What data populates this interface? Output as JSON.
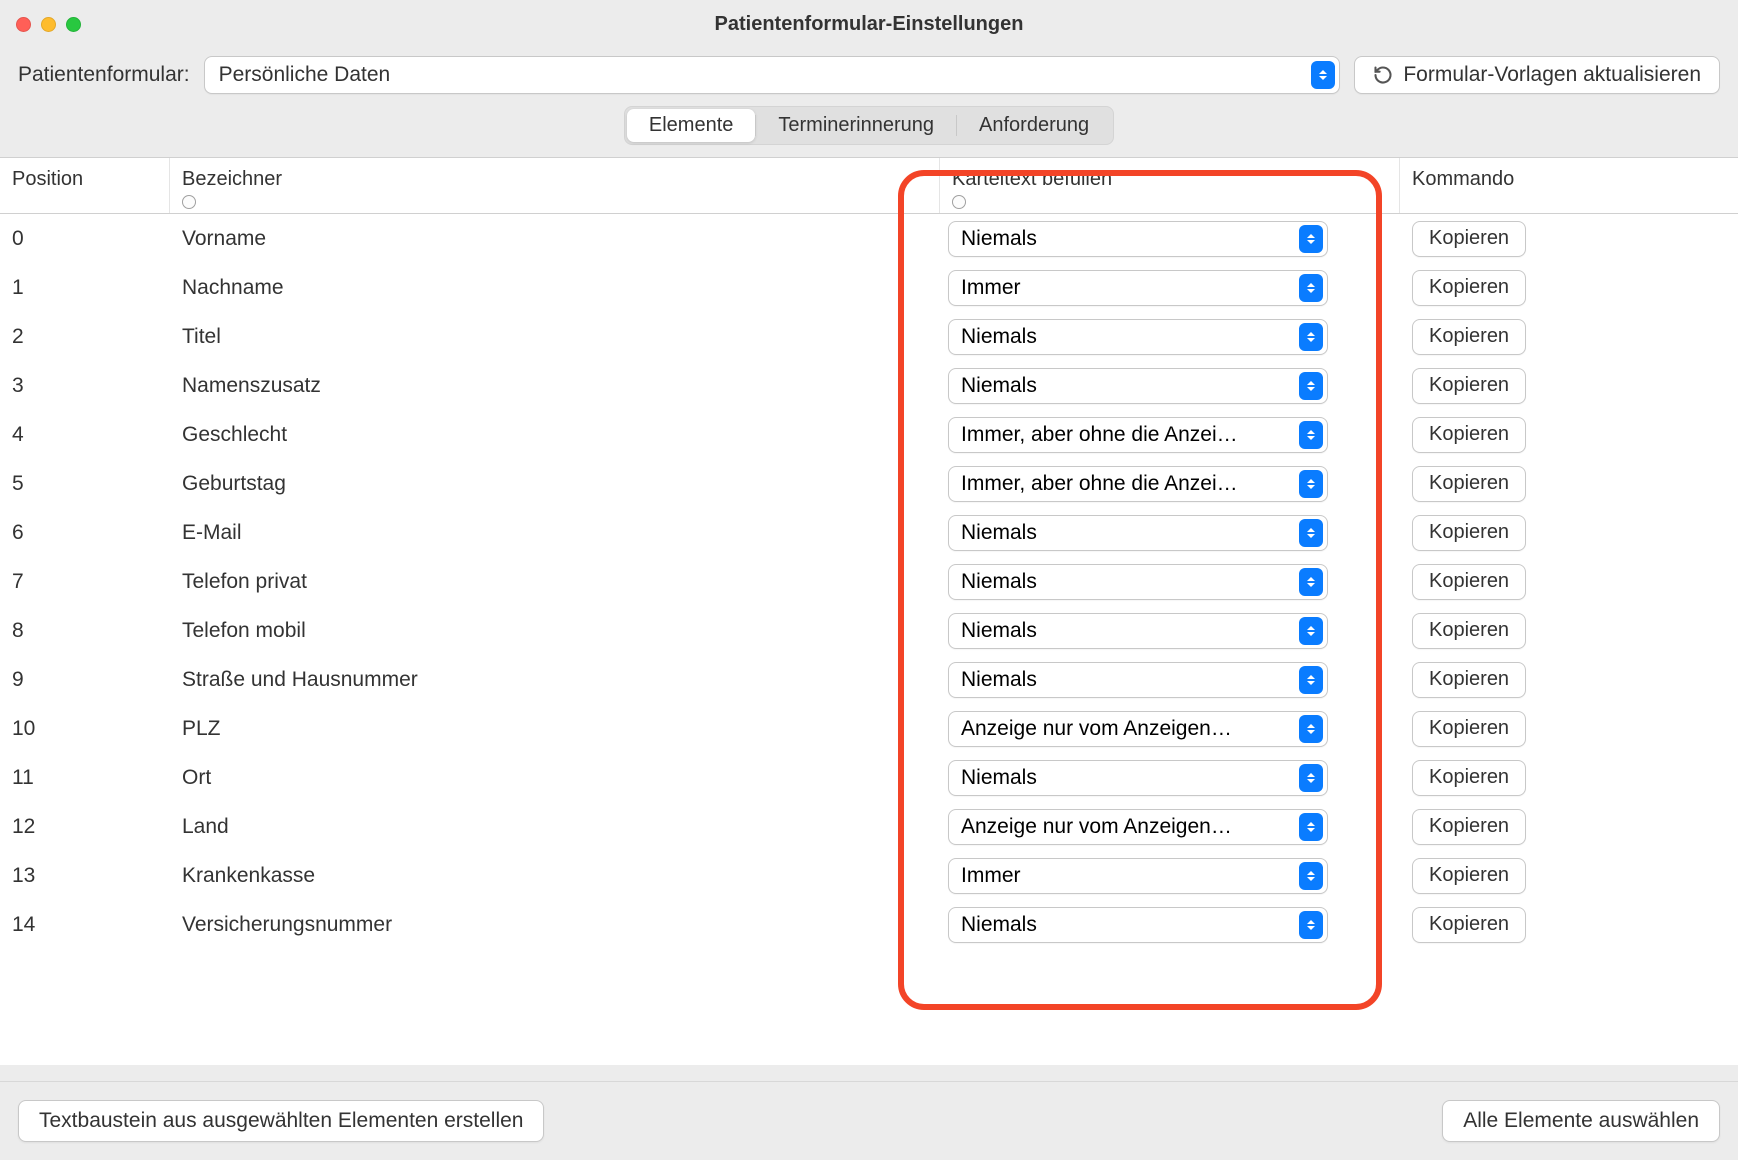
{
  "window": {
    "title": "Patientenformular-Einstellungen"
  },
  "toolbar": {
    "form_label": "Patientenformular:",
    "selected_form": "Persönliche Daten",
    "update_templates": "Formular-Vorlagen aktualisieren"
  },
  "tabs": {
    "elements": "Elemente",
    "reminder": "Terminerinnerung",
    "requirement": "Anforderung"
  },
  "table": {
    "headers": {
      "position": "Position",
      "identifier": "Bezeichner",
      "fill_card_text": "Karteitext befüllen",
      "command": "Kommando"
    },
    "copy_label": "Kopieren",
    "rows": [
      {
        "position": "0",
        "identifier": "Vorname",
        "fill": "Niemals"
      },
      {
        "position": "1",
        "identifier": "Nachname",
        "fill": "Immer"
      },
      {
        "position": "2",
        "identifier": "Titel",
        "fill": "Niemals"
      },
      {
        "position": "3",
        "identifier": "Namenszusatz",
        "fill": "Niemals"
      },
      {
        "position": "4",
        "identifier": "Geschlecht",
        "fill": "Immer, aber ohne die Anzei…"
      },
      {
        "position": "5",
        "identifier": "Geburtstag",
        "fill": "Immer, aber ohne die Anzei…"
      },
      {
        "position": "6",
        "identifier": "E-Mail",
        "fill": "Niemals"
      },
      {
        "position": "7",
        "identifier": "Telefon privat",
        "fill": "Niemals"
      },
      {
        "position": "8",
        "identifier": "Telefon mobil",
        "fill": "Niemals"
      },
      {
        "position": "9",
        "identifier": "Straße und Hausnummer",
        "fill": "Niemals"
      },
      {
        "position": "10",
        "identifier": "PLZ",
        "fill": "Anzeige nur vom Anzeigen…"
      },
      {
        "position": "11",
        "identifier": "Ort",
        "fill": "Niemals"
      },
      {
        "position": "12",
        "identifier": "Land",
        "fill": "Anzeige nur vom Anzeigen…"
      },
      {
        "position": "13",
        "identifier": "Krankenkasse",
        "fill": "Immer"
      },
      {
        "position": "14",
        "identifier": "Versicherungsnummer",
        "fill": "Niemals"
      }
    ]
  },
  "footer": {
    "create_textblock": "Textbaustein aus ausgewählten Elementen erstellen",
    "select_all": "Alle Elemente auswählen"
  }
}
